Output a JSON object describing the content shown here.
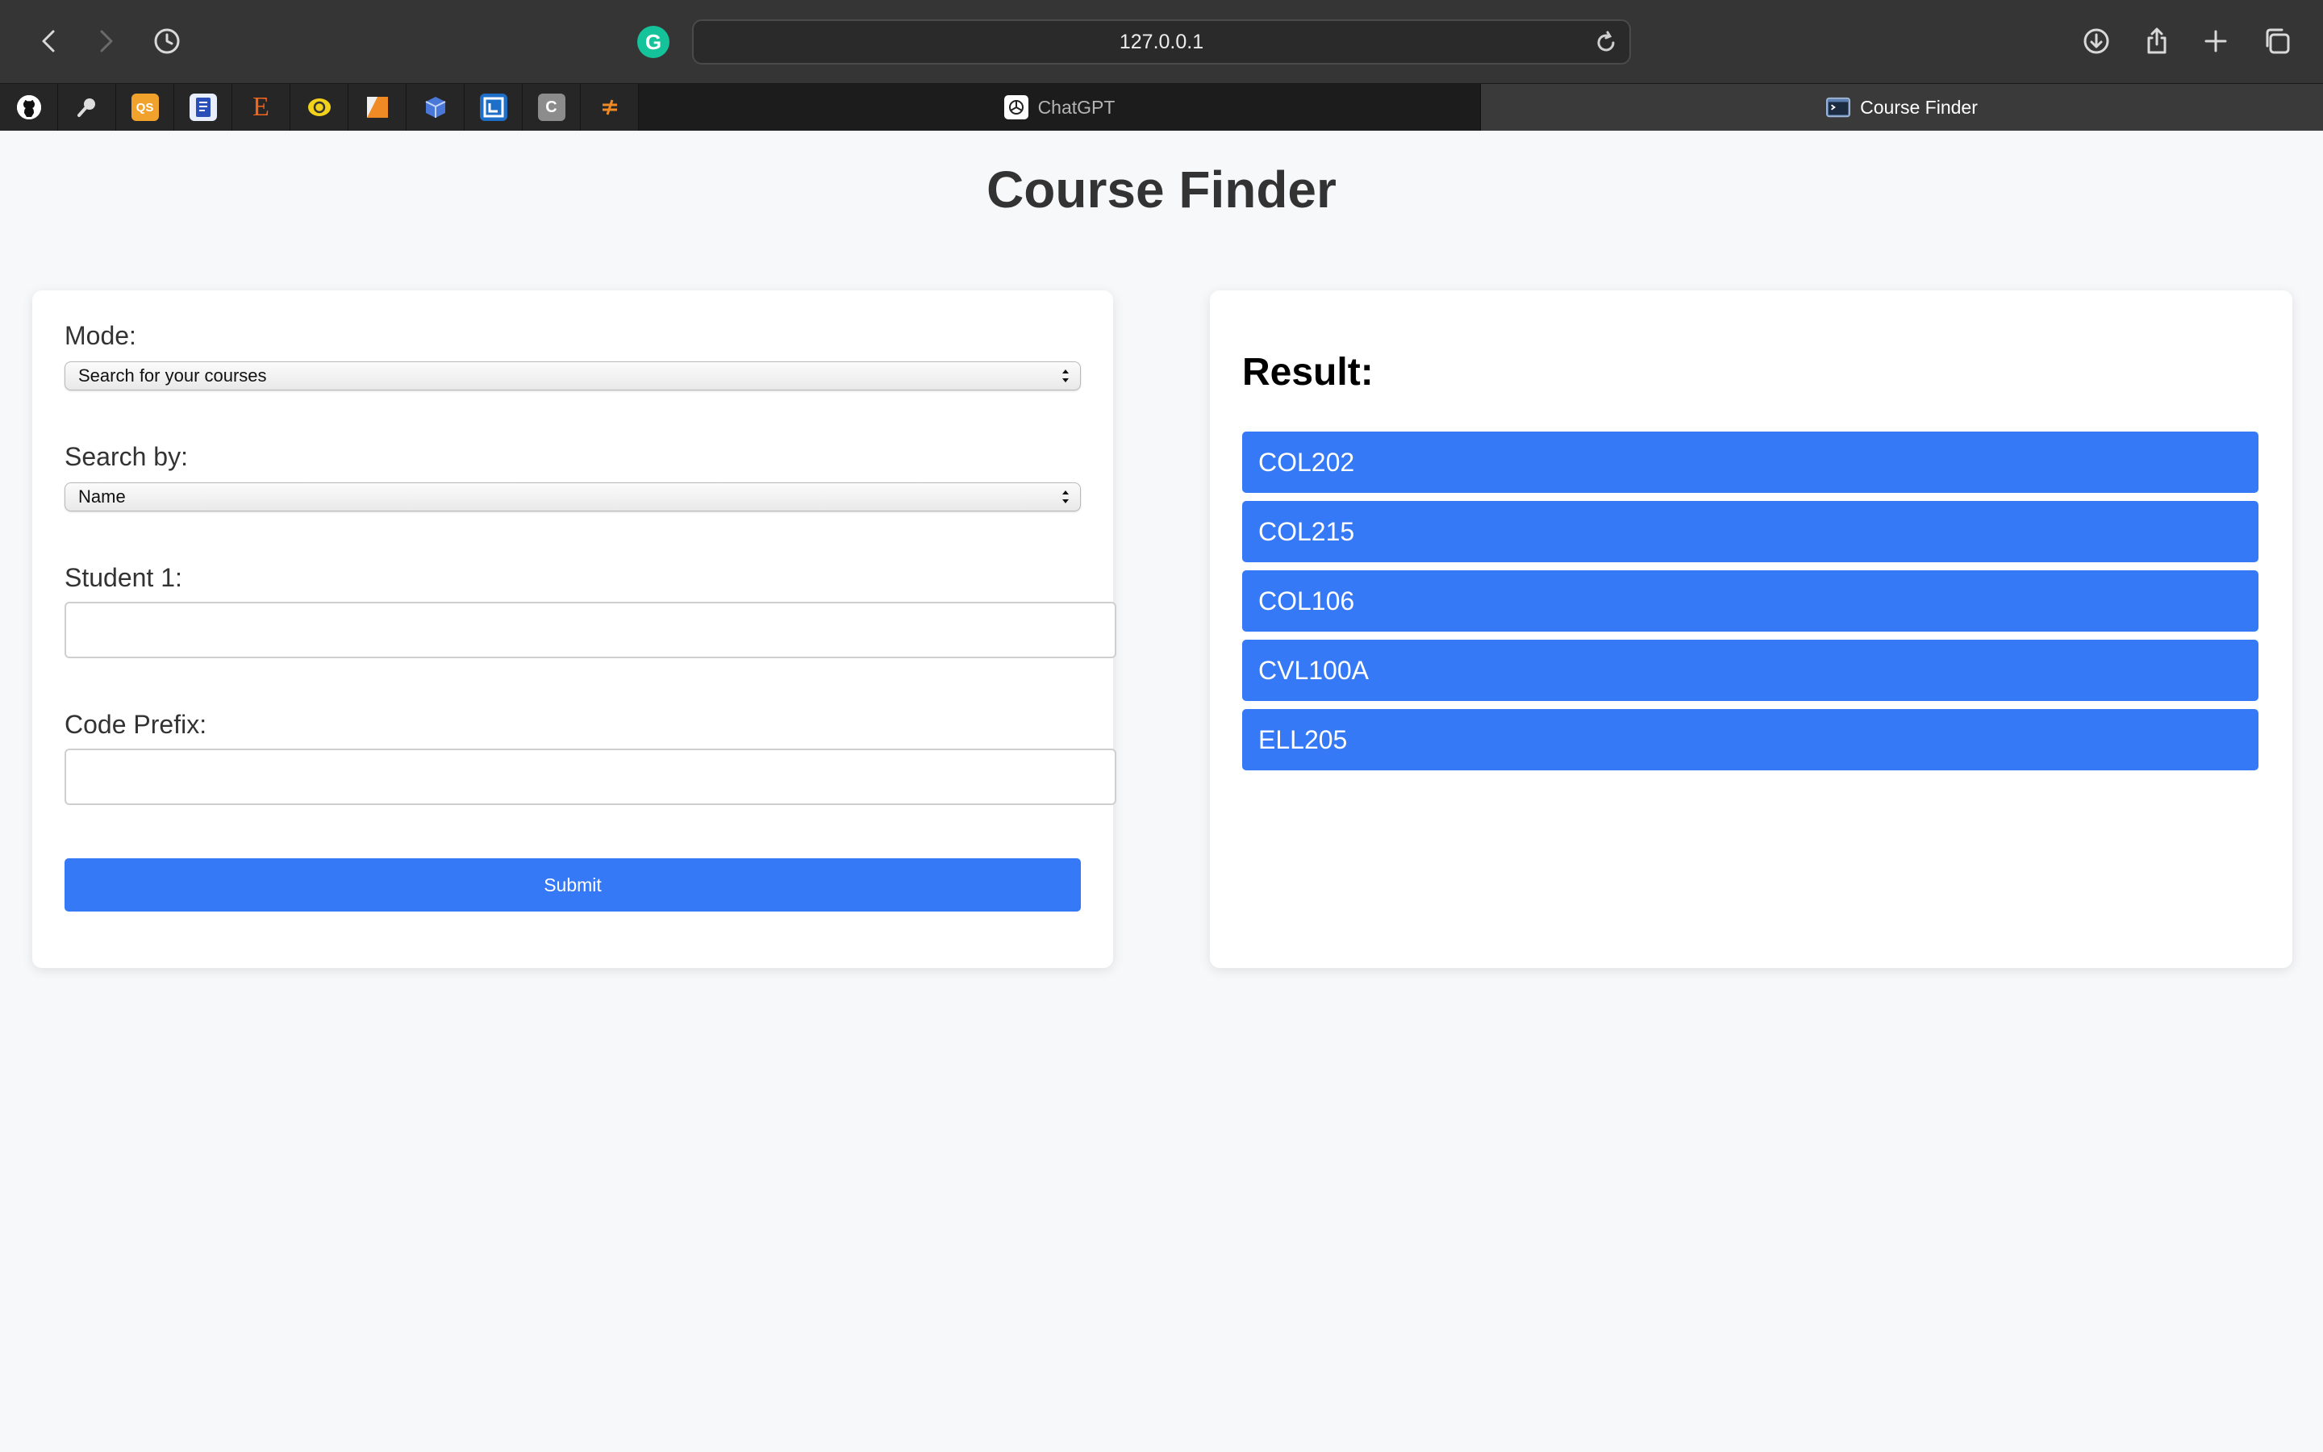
{
  "browser": {
    "url": "127.0.0.1",
    "tabs": [
      {
        "label": "ChatGPT"
      },
      {
        "label": "Course Finder"
      }
    ],
    "pinned_icons": [
      "github-icon",
      "magnifier-icon",
      "qs-icon",
      "book-icon",
      "etsy-icon",
      "smiley-icon",
      "orange-square-icon",
      "cube-icon",
      "frame-icon",
      "c-icon",
      "sync-icon"
    ],
    "pinned_labels": {
      "qs": "QS",
      "etsy": "E",
      "c": "C"
    }
  },
  "page": {
    "title": "Course Finder"
  },
  "form": {
    "mode_label": "Mode:",
    "mode_value": "Search for your courses",
    "search_by_label": "Search by:",
    "search_by_value": "Name",
    "student_label": "Student 1:",
    "student_value": "",
    "prefix_label": "Code Prefix:",
    "prefix_value": "",
    "submit_label": "Submit"
  },
  "result": {
    "heading": "Result:",
    "items": [
      "COL202",
      "COL215",
      "COL106",
      "CVL100A",
      "ELL205"
    ]
  },
  "colors": {
    "accent": "#3579f6",
    "page_bg": "#f7f8fa",
    "title": "#333333"
  }
}
